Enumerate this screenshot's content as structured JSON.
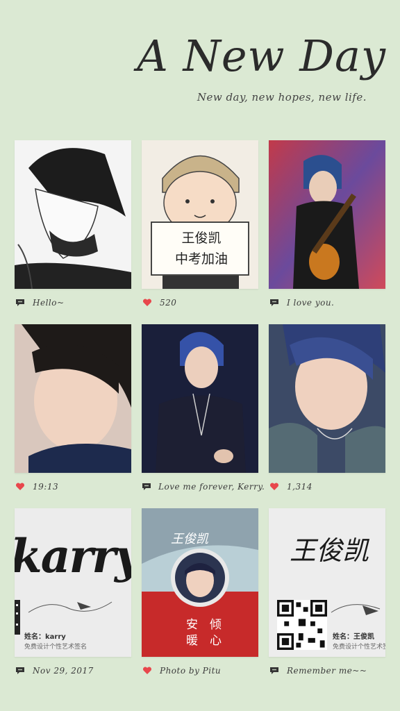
{
  "header": {
    "title": "A New Day",
    "subtitle": "New day, new hopes, new life."
  },
  "posts": [
    {
      "caption": "Hello~",
      "icon": "comment-icon"
    },
    {
      "caption": "520",
      "icon": "heart-icon"
    },
    {
      "caption": "I love you.",
      "icon": "comment-icon"
    },
    {
      "caption": "19:13",
      "icon": "heart-icon"
    },
    {
      "caption": "Love me forever, Kerry.",
      "icon": "comment-icon"
    },
    {
      "caption": "1,314",
      "icon": "heart-icon"
    },
    {
      "caption": "Nov 29, 2017",
      "icon": "comment-icon"
    },
    {
      "caption": "Photo by Pitu",
      "icon": "heart-icon"
    },
    {
      "caption": "Remember me~~",
      "icon": "comment-icon"
    }
  ],
  "photo_text": {
    "sign_card": "王俊凯\n中考加油",
    "karry_script": "karry",
    "karry_name": "姓名：karry",
    "karry_sub": "免费设计个性艺术签名",
    "pitu_sig": "王俊凯",
    "pitu_vert_a": "安暖",
    "pitu_vert_b": "倾心",
    "wang_sig": "王俊凯",
    "wang_name": "姓名：王俊凯",
    "wang_sub": "免费设计个性艺术签名"
  },
  "colors": {
    "background": "#dbe9d3",
    "heart": "#e8474c",
    "comment": "#333333"
  }
}
